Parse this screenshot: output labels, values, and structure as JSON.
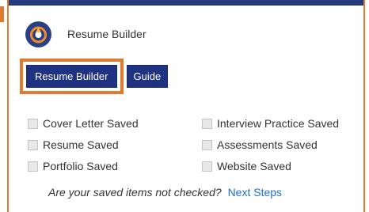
{
  "header": {
    "title": "Resume Builder",
    "logo_icon": "orbit-logo-icon"
  },
  "buttons": {
    "resume_builder_label": "Resume Builder",
    "guide_label": "Guide"
  },
  "checklist": {
    "rows": [
      {
        "left": "Cover Letter Saved",
        "right": "Interview Practice Saved"
      },
      {
        "left": "Resume Saved",
        "right": "Assessments Saved"
      },
      {
        "left": "Portfolio Saved",
        "right": "Website Saved"
      }
    ]
  },
  "footer": {
    "question": "Are your saved items not checked?",
    "link": "Next Steps"
  },
  "colors": {
    "accent_orange": "#e07a2e",
    "brand_navy": "#1f3382",
    "link_blue": "#1f6fd1"
  }
}
